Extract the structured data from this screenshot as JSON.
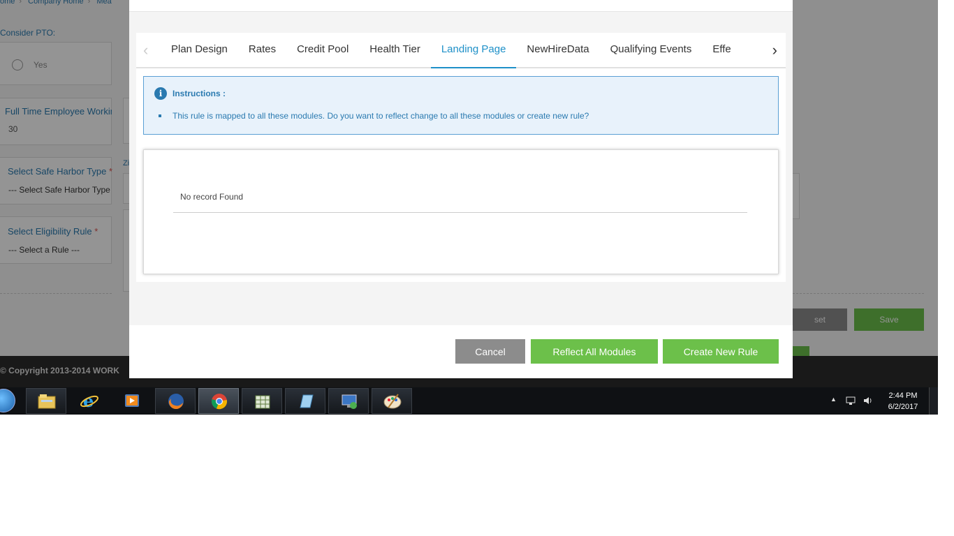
{
  "background": {
    "breadcrumb": [
      "ome",
      "Company Home",
      "Mea"
    ],
    "consider_pto_label": "Consider PTO:",
    "pto_option": "Yes",
    "ft_hours_label": "Full Time Employee Workin",
    "ft_hours_value": "30",
    "zi_label": "Zi",
    "safe_harbor_label": "Select Safe Harbor Type",
    "safe_harbor_placeholder": "--- Select Safe Harbor Type",
    "eligibility_label": "Select Eligibility Rule",
    "eligibility_placeholder": "--- Select a Rule ---",
    "required_mark": "*",
    "reset_label": "set",
    "save_label": "Save",
    "footer": "© Copyright 2013-2014 WORK"
  },
  "modal": {
    "tabs": [
      "Plan Design",
      "Rates",
      "Credit Pool",
      "Health Tier",
      "Landing Page",
      "NewHireData",
      "Qualifying Events",
      "Effe"
    ],
    "active_tab": "Landing Page",
    "prev_arrow": "‹",
    "next_arrow": "›",
    "instructions": {
      "icon": "i",
      "title": "Instructions :",
      "items": [
        "This rule is mapped to all these modules. Do you want to reflect change to all these modules or create new rule?"
      ]
    },
    "records_empty_text": "No record Found",
    "buttons": {
      "cancel": "Cancel",
      "reflect": "Reflect All Modules",
      "create": "Create New Rule"
    }
  },
  "taskbar": {
    "apps": [
      "start-orb",
      "file-explorer-icon",
      "internet-explorer-icon",
      "media-player-icon",
      "firefox-icon",
      "chrome-icon",
      "spreadsheet-icon",
      "notepad-icon",
      "remote-desktop-icon",
      "paint-icon"
    ],
    "active_app": "chrome-icon",
    "time": "2:44 PM",
    "date": "6/2/2017"
  },
  "colors": {
    "accent_blue": "#1e90c8",
    "green_button": "#6cc04a",
    "cancel_gray": "#8c8c8c"
  }
}
